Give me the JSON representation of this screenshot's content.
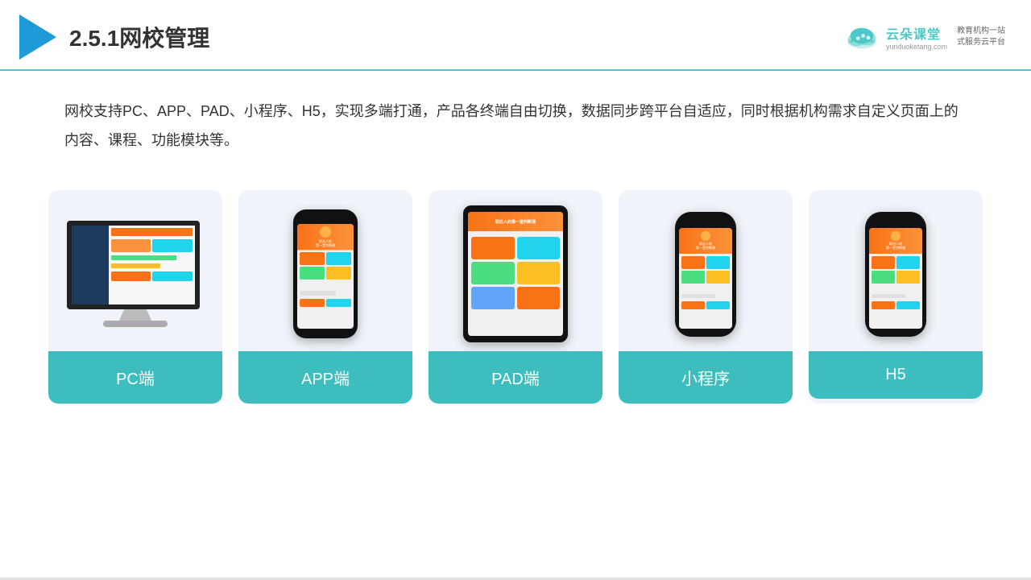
{
  "header": {
    "title": "2.5.1网校管理",
    "brand": {
      "name": "云朵课堂",
      "url": "yunduoketang.com",
      "slogan": "教育机构一站\n式服务云平台"
    }
  },
  "description": {
    "text": "网校支持PC、APP、PAD、小程序、H5，实现多端打通，产品各终端自由切换，数据同步跨平台自适应，同时根据机构需求自定义页面上的内容、课程、功能模块等。"
  },
  "cards": [
    {
      "id": "pc",
      "label": "PC端"
    },
    {
      "id": "app",
      "label": "APP端"
    },
    {
      "id": "pad",
      "label": "PAD端"
    },
    {
      "id": "miniprogram",
      "label": "小程序"
    },
    {
      "id": "h5",
      "label": "H5"
    }
  ],
  "colors": {
    "accent": "#3dbdbd",
    "header_line": "#4dc8c8",
    "bg_card": "#f0f4fa",
    "text_primary": "#333333"
  }
}
